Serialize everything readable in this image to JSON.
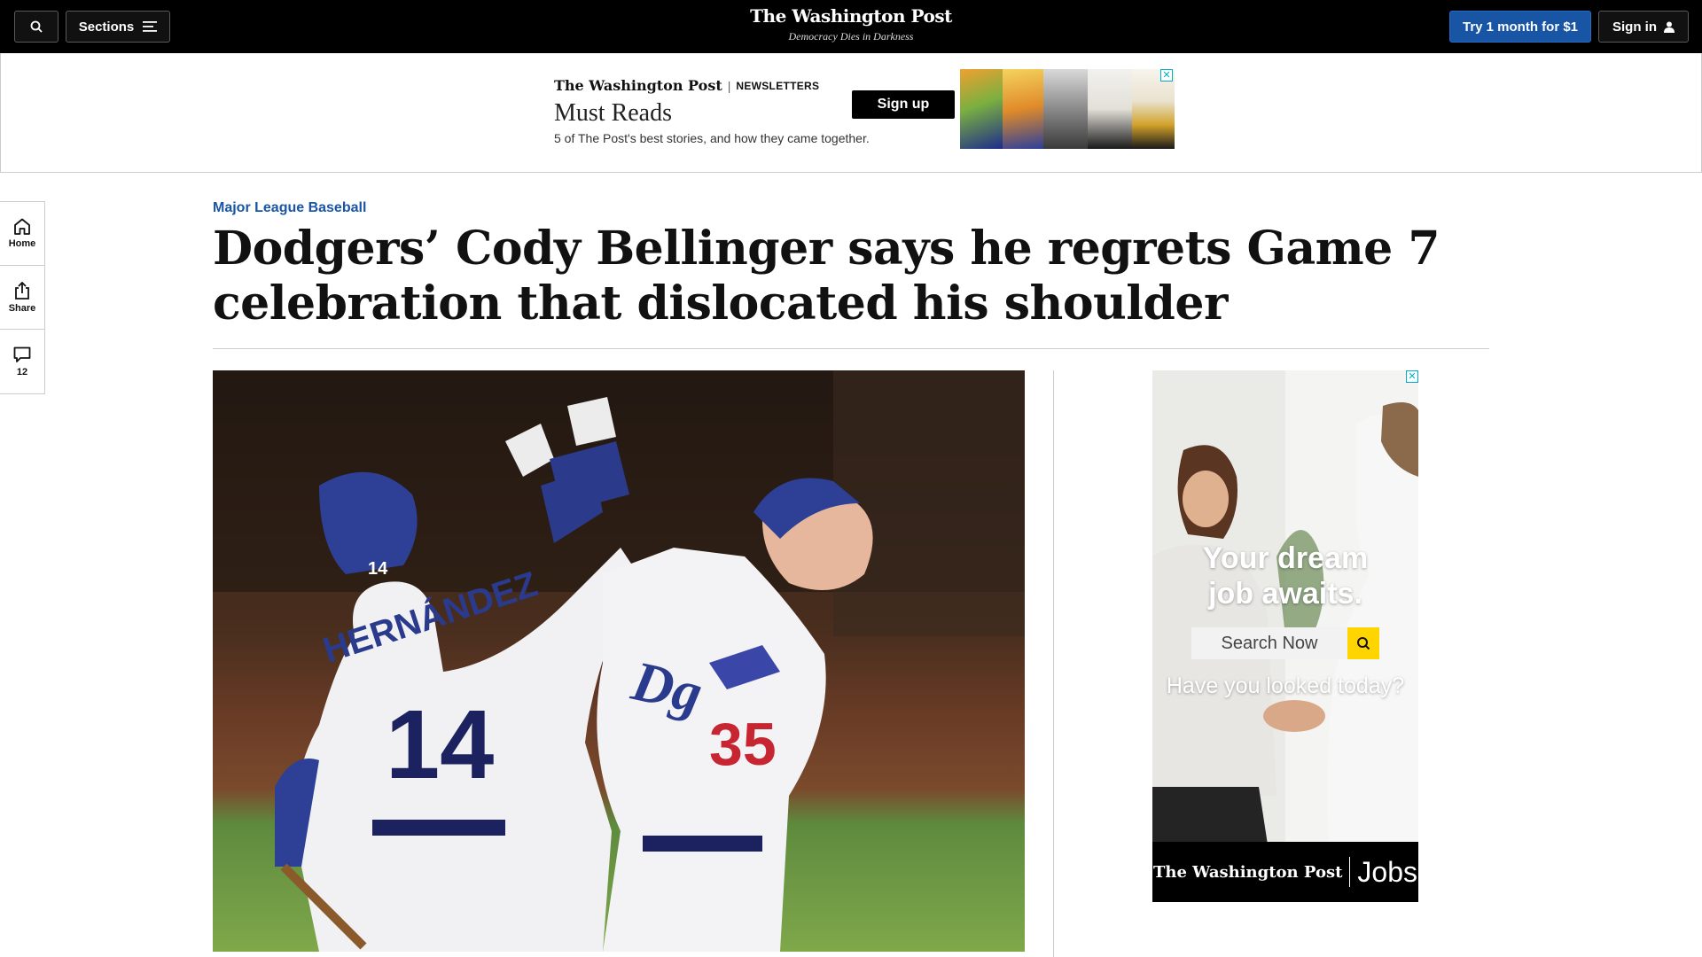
{
  "header": {
    "sections_label": "Sections",
    "logo_name": "The Washington Post",
    "tagline": "Democracy Dies in Darkness",
    "subscribe_label": "Try 1 month for $1",
    "signin_label": "Sign in"
  },
  "top_ad": {
    "brand": "The Washington Post",
    "brand_sub": "NEWSLETTERS",
    "title": "Must Reads",
    "description": "5 of The Post's best stories, and how they came together.",
    "cta": "Sign up",
    "close": "✕"
  },
  "rail": {
    "home_label": "Home",
    "share_label": "Share",
    "comments_count": "12"
  },
  "article": {
    "kicker": "Major League Baseball",
    "headline": "Dodgers’ Cody Bellinger says he regrets Game 7 celebration that dislocated his shoulder",
    "photo": {
      "left_name": "HERNÁNDEZ",
      "left_number": "14",
      "right_number": "35",
      "helmet_number": "14"
    }
  },
  "side_ad": {
    "headline_line1": "Your dream",
    "headline_line2": "job awaits.",
    "search_label": "Search Now",
    "subline": "Have you looked today?",
    "footer_brand": "The Washington Post",
    "footer_product": "Jobs",
    "close": "✕"
  }
}
